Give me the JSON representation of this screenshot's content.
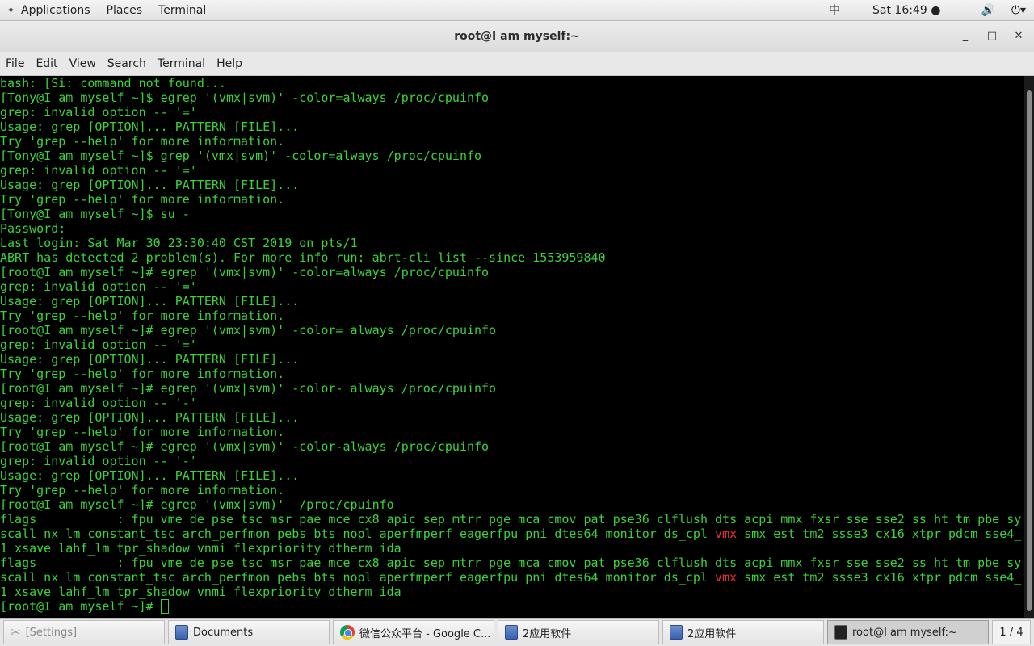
{
  "topbar": {
    "applications": "Applications",
    "places": "Places",
    "terminal": "Terminal",
    "input_method": "中",
    "clock": "Sat 16:49 ●",
    "volume_icon": "volume-icon",
    "power_icon": "power-icon"
  },
  "window": {
    "title": "root@I am myself:~",
    "minimize": "_",
    "maximize": "□",
    "close": "✕"
  },
  "menubar": [
    "File",
    "Edit",
    "View",
    "Search",
    "Terminal",
    "Help"
  ],
  "colors": {
    "text": "#3ad43a",
    "highlight": "#e8303a",
    "background": "#000000"
  },
  "terminal": {
    "lines": [
      [
        "bash: [Si: command not found..."
      ],
      [
        "[Tony@I am myself ~]$ egrep '(vmx|svm)' -color=always /proc/cpuinfo"
      ],
      [
        "grep: invalid option -- '='"
      ],
      [
        "Usage: grep [OPTION]... PATTERN [FILE]..."
      ],
      [
        "Try 'grep --help' for more information."
      ],
      [
        "[Tony@I am myself ~]$ grep '(vmx|svm)' -color=always /proc/cpuinfo"
      ],
      [
        "grep: invalid option -- '='"
      ],
      [
        "Usage: grep [OPTION]... PATTERN [FILE]..."
      ],
      [
        "Try 'grep --help' for more information."
      ],
      [
        "[Tony@I am myself ~]$ su -"
      ],
      [
        "Password:"
      ],
      [
        "Last login: Sat Mar 30 23:30:40 CST 2019 on pts/1"
      ],
      [
        "ABRT has detected 2 problem(s). For more info run: abrt-cli list --since 1553959840"
      ],
      [
        "[root@I am myself ~]# egrep '(vmx|svm)' -color=always /proc/cpuinfo"
      ],
      [
        "grep: invalid option -- '='"
      ],
      [
        "Usage: grep [OPTION]... PATTERN [FILE]..."
      ],
      [
        "Try 'grep --help' for more information."
      ],
      [
        "[root@I am myself ~]# egrep '(vmx|svm)' -color= always /proc/cpuinfo"
      ],
      [
        "grep: invalid option -- '='"
      ],
      [
        "Usage: grep [OPTION]... PATTERN [FILE]..."
      ],
      [
        "Try 'grep --help' for more information."
      ],
      [
        "[root@I am myself ~]# egrep '(vmx|svm)' -color- always /proc/cpuinfo"
      ],
      [
        "grep: invalid option -- '-'"
      ],
      [
        "Usage: grep [OPTION]... PATTERN [FILE]..."
      ],
      [
        "Try 'grep --help' for more information."
      ],
      [
        "[root@I am myself ~]# egrep '(vmx|svm)' -color-always /proc/cpuinfo"
      ],
      [
        "grep: invalid option -- '-'"
      ],
      [
        "Usage: grep [OPTION]... PATTERN [FILE]..."
      ],
      [
        "Try 'grep --help' for more information."
      ],
      [
        "[root@I am myself ~]# egrep '(vmx|svm)'  /proc/cpuinfo"
      ],
      [
        "flags           : fpu vme de pse tsc msr pae mce cx8 apic sep mtrr pge mca cmov pat pse36 clflush dts acpi mmx fxsr sse sse2 ss ht tm pbe sy"
      ],
      [
        "scall nx lm constant_tsc arch_perfmon pebs bts nopl aperfmperf eagerfpu pni dtes64 monitor ds_cpl ",
        "vmx",
        " smx est tm2 ssse3 cx16 xtpr pdcm sse4_"
      ],
      [
        "1 xsave lahf_lm tpr_shadow vnmi flexpriority dtherm ida"
      ],
      [
        "flags           : fpu vme de pse tsc msr pae mce cx8 apic sep mtrr pge mca cmov pat pse36 clflush dts acpi mmx fxsr sse sse2 ss ht tm pbe sy"
      ],
      [
        "scall nx lm constant_tsc arch_perfmon pebs bts nopl aperfmperf eagerfpu pni dtes64 monitor ds_cpl ",
        "vmx",
        " smx est tm2 ssse3 cx16 xtpr pdcm sse4_"
      ],
      [
        "1 xsave lahf_lm tpr_shadow vnmi flexpriority dtherm ida"
      ],
      [
        "[root@I am myself ~]# "
      ]
    ]
  },
  "taskbar": {
    "items": [
      {
        "label": "[Settings]",
        "icon": "settings-icon"
      },
      {
        "label": "Documents",
        "icon": "file-manager-icon"
      },
      {
        "label": "微信公众平台 - Google C...",
        "icon": "chrome-icon"
      },
      {
        "label": "2应用软件",
        "icon": "file-manager-icon"
      },
      {
        "label": "2应用软件",
        "icon": "file-manager-icon"
      },
      {
        "label": "root@I am myself:~",
        "icon": "terminal-icon"
      }
    ],
    "pager": "1 / 4"
  }
}
